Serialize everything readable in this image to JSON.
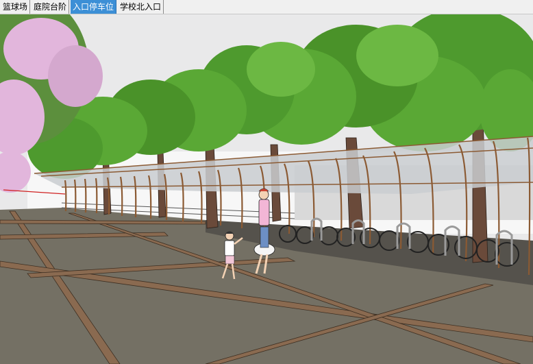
{
  "scene_tabs": [
    {
      "label": "篮球场",
      "active": false
    },
    {
      "label": "庭院台阶",
      "active": false
    },
    {
      "label": "入口停车位",
      "active": true
    },
    {
      "label": "学校北入口",
      "active": false
    }
  ],
  "colors": {
    "tab_active_bg": "#3c8fd6",
    "tab_bar_bg": "#f0f0f0",
    "sky": "#e9e9ea",
    "pavement": "#747064",
    "pavement_band": "#8a6a50",
    "canopy_frame": "#8b5a33",
    "foliage": "#4e9a2e",
    "blossom": "#e2b6dc"
  },
  "icons": {
    "people": "person-figure-icon",
    "bicycle": "bicycle-icon"
  }
}
